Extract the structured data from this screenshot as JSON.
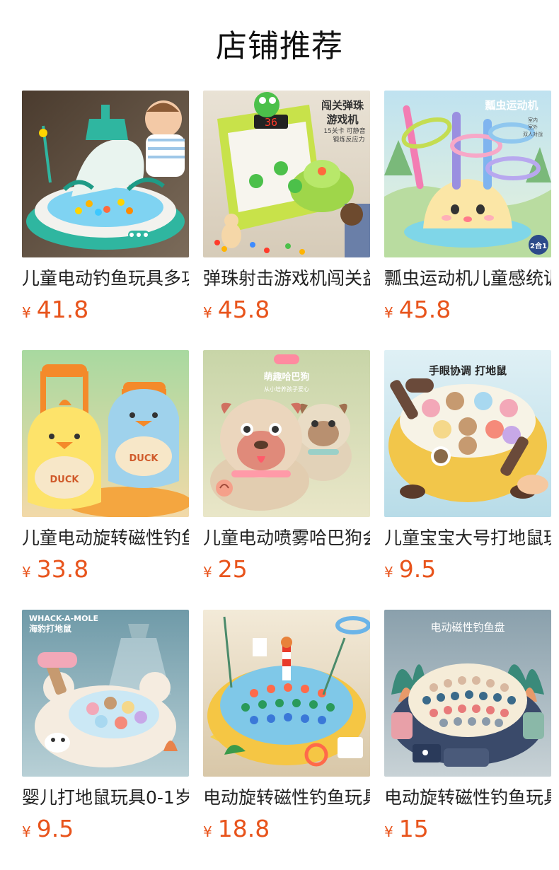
{
  "section": {
    "title": "店铺推荐"
  },
  "currency_symbol": "¥",
  "products": [
    {
      "name": "儿童电动钓鱼玩具多功能",
      "price": "41.8",
      "image": "fishing-playset-image",
      "image_text": []
    },
    {
      "name": "弹珠射击游戏机闯关益智",
      "price": "45.8",
      "image": "marble-shooter-image",
      "image_text": [
        "闯关弹珠",
        "游戏机",
        "36",
        "15关卡 可静音",
        "锻炼反应力"
      ]
    },
    {
      "name": "瓢虫运动机儿童感统训练",
      "price": "45.8",
      "image": "ladybug-ring-toss-image",
      "image_text": [
        "瓢虫运动机",
        "室内",
        "室外",
        "双人对战",
        "2合1"
      ]
    },
    {
      "name": "儿童电动旋转磁性钓鱼",
      "price": "33.8",
      "image": "duck-trolley-image",
      "image_text": [
        "DUCK",
        "DUCK"
      ]
    },
    {
      "name": "儿童电动喷雾哈巴狗会走",
      "price": "25",
      "image": "pug-robot-image",
      "image_text": [
        "萌趣哈巴狗",
        "从小培养孩子爱心"
      ]
    },
    {
      "name": "儿童宝宝大号打地鼠玩具",
      "price": "9.5",
      "image": "whack-a-mole-yellow-image",
      "image_text": [
        "手眼协调 打地鼠"
      ]
    },
    {
      "name": "婴儿打地鼠玩具0-1岁",
      "price": "9.5",
      "image": "seal-whack-a-mole-image",
      "image_text": [
        "WHACK-A-MOLE",
        "海豹打地鼠"
      ]
    },
    {
      "name": "电动旋转磁性钓鱼玩具",
      "price": "18.8",
      "image": "fishing-game-yellow-image",
      "image_text": []
    },
    {
      "name": "电动旋转磁性钓鱼玩具",
      "price": "15",
      "image": "fishing-game-grey-image",
      "image_text": [
        "电动磁性钓鱼盘"
      ]
    }
  ]
}
